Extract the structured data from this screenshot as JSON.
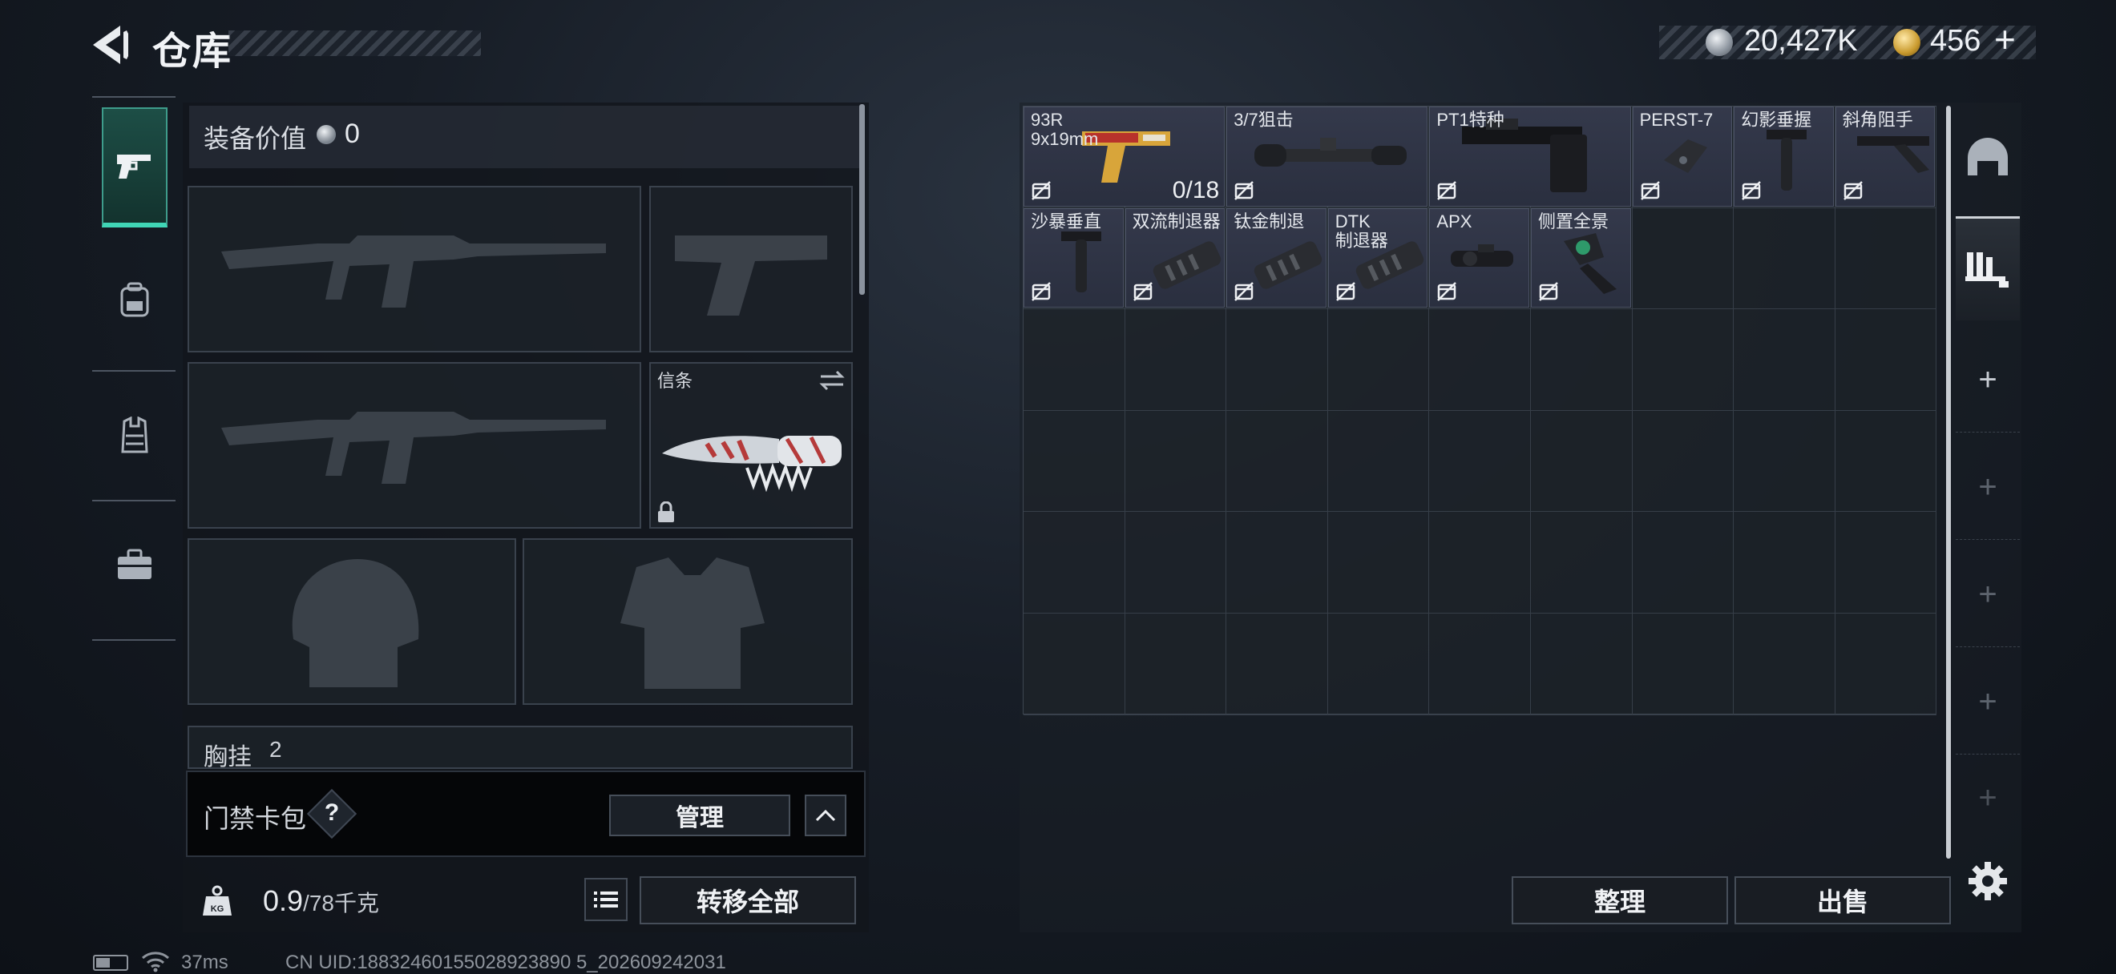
{
  "header": {
    "title": "仓库",
    "currency": {
      "silver": "20,427K",
      "gold": "456",
      "plus": "+"
    }
  },
  "nav": {
    "tabs": [
      {
        "name": "weapons",
        "icon": "pistol-icon",
        "active": true
      },
      {
        "name": "backpack",
        "icon": "backpack-icon",
        "active": false
      },
      {
        "name": "rig",
        "icon": "vest-icon",
        "active": false
      },
      {
        "name": "cases",
        "icon": "briefcase-icon",
        "active": false
      }
    ]
  },
  "equipment": {
    "value_label": "装备价值",
    "value": "0",
    "knife_label": "信条",
    "chest_rig_label": "胸挂",
    "chest_rig_count": "2"
  },
  "card_pack": {
    "label": "门禁卡包",
    "help": "?",
    "manage": "管理"
  },
  "footer_left": {
    "weight_current": "0.9",
    "weight_max": "/78千克",
    "weight_icon_text": "KG",
    "transfer_all": "转移全部"
  },
  "status": {
    "ping": "37ms",
    "uid": "CN UID:18832460155028923890 5_202609242031",
    "battery_level": 0.45
  },
  "stash": {
    "items": [
      {
        "name": "93R\n9x19mm",
        "count": "0/18",
        "icon": "pistol-gold-icon"
      },
      {
        "name": "3/7狙击",
        "count": "",
        "icon": "sniper-scope-icon"
      },
      {
        "name": "PT1特种",
        "count": "",
        "icon": "stock-icon"
      },
      {
        "name": "PERST-7",
        "count": "",
        "icon": "laser-module-icon"
      },
      {
        "name": "幻影垂握",
        "count": "",
        "icon": "vertical-grip-icon"
      },
      {
        "name": "斜角阻手",
        "count": "",
        "icon": "angled-grip-icon"
      },
      {
        "name": "沙暴垂直",
        "count": "",
        "icon": "vertical-grip-icon"
      },
      {
        "name": "双流制退器",
        "count": "",
        "icon": "muzzle-brake-icon"
      },
      {
        "name": "钛金制退",
        "count": "",
        "icon": "muzzle-brake-icon"
      },
      {
        "name": "DTK\n制退器",
        "count": "",
        "icon": "muzzle-brake-icon"
      },
      {
        "name": "APX",
        "count": "",
        "icon": "red-dot-sight-icon"
      },
      {
        "name": "侧置全景",
        "count": "",
        "icon": "side-sight-icon"
      }
    ],
    "sort": "整理",
    "sell": "出售"
  },
  "rail": {
    "tabs": [
      {
        "icon": "helmet-icon"
      },
      {
        "icon": "storage-icon",
        "active": true
      }
    ],
    "plus": "+"
  },
  "colors": {
    "accent": "#40d6b6",
    "item_bg": "#2f3446",
    "panel": "#12161c"
  }
}
